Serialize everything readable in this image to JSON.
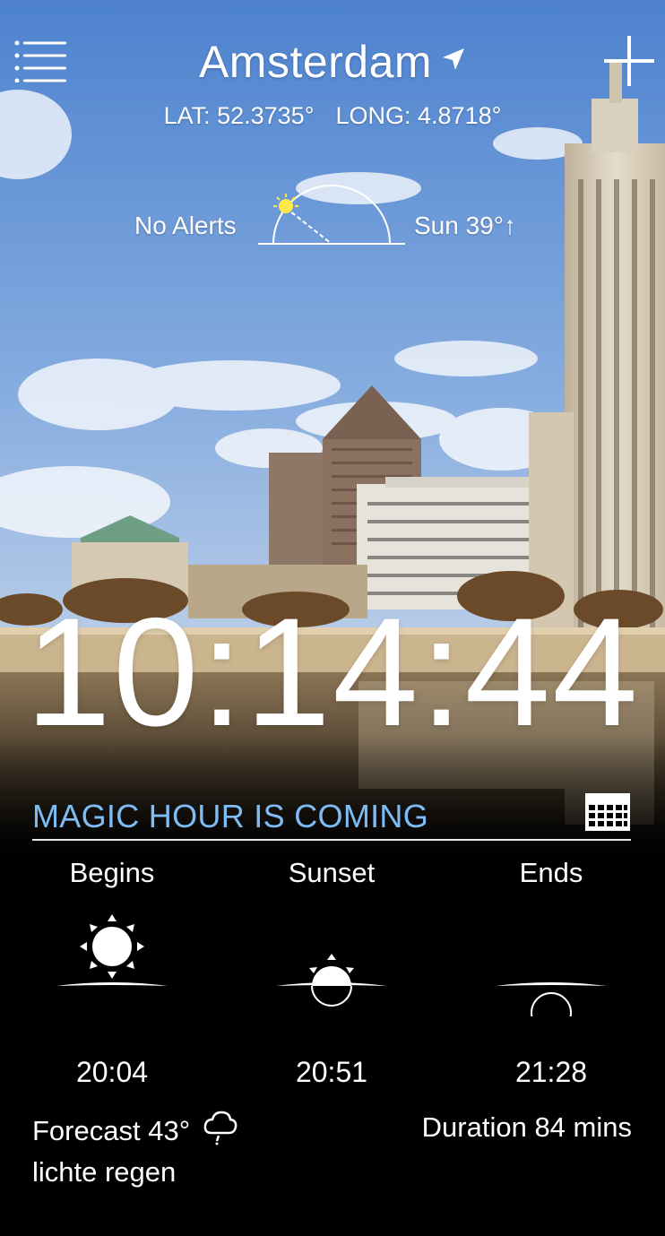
{
  "header": {
    "city": "Amsterdam",
    "lat_label": "LAT: 52.3735°",
    "long_label": "LONG: 4.8718°"
  },
  "sun_status": {
    "alerts": "No Alerts",
    "elevation": "Sun 39°↑"
  },
  "clock": {
    "time": "10:14:44"
  },
  "magic_hour": {
    "title": "MAGIC HOUR IS COMING",
    "columns": [
      {
        "label": "Begins",
        "time": "20:04",
        "icon": "sun-above-horizon-icon"
      },
      {
        "label": "Sunset",
        "time": "20:51",
        "icon": "sun-on-horizon-icon"
      },
      {
        "label": "Ends",
        "time": "21:28",
        "icon": "sun-below-horizon-icon"
      }
    ]
  },
  "forecast": {
    "text": "Forecast 43°",
    "icon": "light-rain-icon",
    "condition": "lichte regen"
  },
  "duration": {
    "text": "Duration 84 mins"
  },
  "colors": {
    "accent": "#7dbcf5",
    "background": "#000000",
    "text": "#ffffff",
    "sun": "#ffe94a"
  },
  "icons": {
    "menu": "menu-list-icon",
    "add": "plus-icon",
    "location": "location-arrow-icon",
    "calendar": "calendar-icon"
  }
}
